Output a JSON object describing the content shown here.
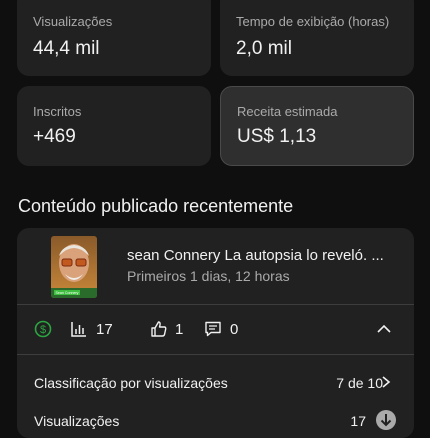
{
  "metrics": [
    {
      "label": "Visualizações",
      "value": "44,4 mil"
    },
    {
      "label": "Tempo de exibição (horas)",
      "value": "2,0 mil"
    },
    {
      "label": "Inscritos",
      "value": "+469"
    },
    {
      "label": "Receita estimada",
      "value": "US$ 1,13"
    }
  ],
  "section_title": "Conteúdo publicado recentemente",
  "video": {
    "title": "sean Connery La autopsia lo reveló. ...",
    "subtitle": "Primeiros 1 dias, 12 horas",
    "thumb_caption": "Sean Connery"
  },
  "stats": {
    "bars": "17",
    "likes": "1",
    "comments": "0"
  },
  "rows": [
    {
      "label": "Classificação por visualizações",
      "value": "7 de 10"
    },
    {
      "label": "Visualizações",
      "value": "17"
    }
  ],
  "colors": {
    "background": "#0f0f0f",
    "card": "#212121",
    "card_selected": "#2f2f2f",
    "monetization_green": "#2ba640"
  }
}
